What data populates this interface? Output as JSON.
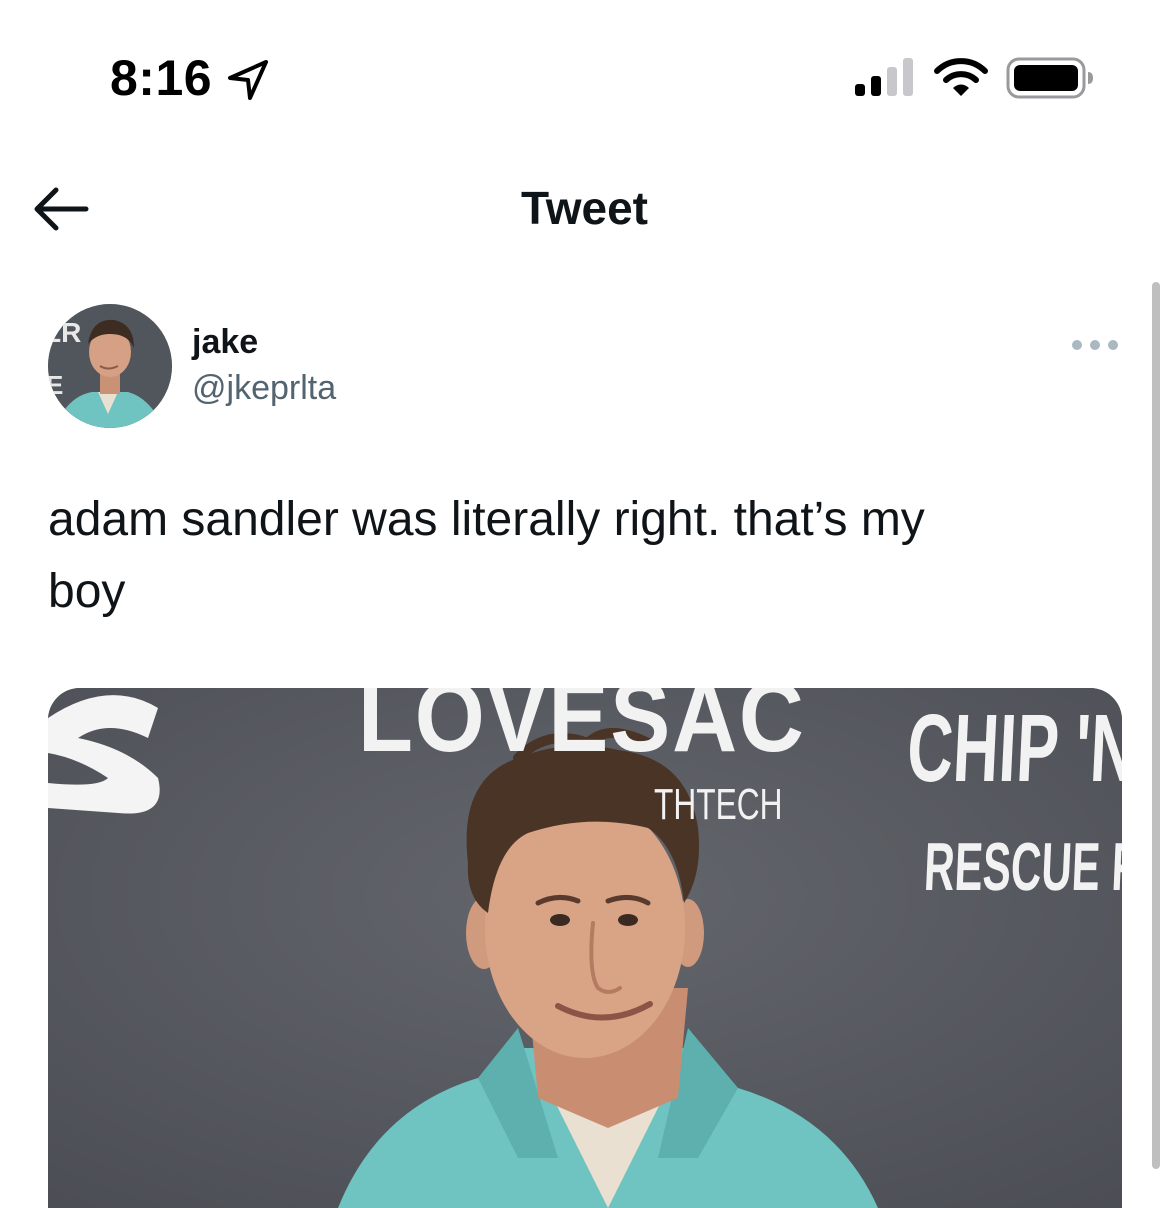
{
  "status_bar": {
    "time": "8:16",
    "location_icon": "location-arrow-icon",
    "signal_icon": "cellular-signal-icon",
    "wifi_icon": "wifi-icon",
    "battery_icon": "battery-icon"
  },
  "header": {
    "back_icon": "arrow-left-icon",
    "title": "Tweet"
  },
  "tweet": {
    "author": {
      "display_name": "jake",
      "handle": "@jkeprlta"
    },
    "more_icon": "more-horizontal-icon",
    "text_line1": "adam sandler was literally right. that’s my",
    "text_line2": "boy",
    "media": {
      "backdrop_text": {
        "sponsor": "LOVESAC",
        "sponsor_sub": "THTECH",
        "film_line1": "CHIP 'N",
        "film_line2": "RESCUE R"
      }
    }
  },
  "colors": {
    "text_primary": "#0f1419",
    "text_secondary": "#536471",
    "backdrop": "#55585e",
    "jacket": "#6fc3c0"
  }
}
